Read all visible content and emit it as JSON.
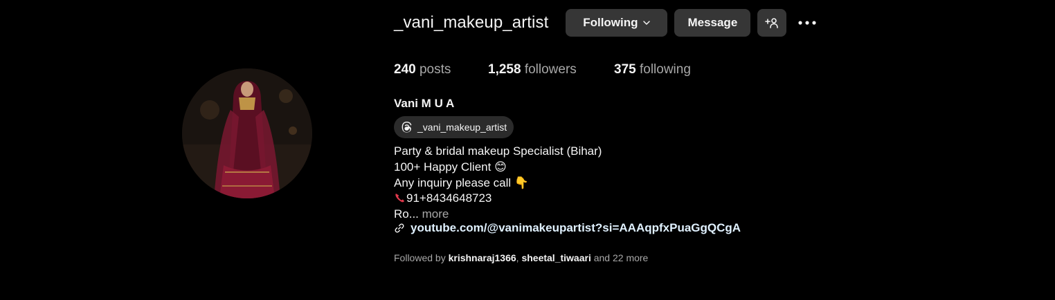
{
  "profile": {
    "username": "_vani_makeup_artist",
    "following_button": "Following",
    "message_button": "Message",
    "posts_count": "240",
    "posts_label": "posts",
    "followers_count": "1,258",
    "followers_label": "followers",
    "following_count": "375",
    "following_label": "following",
    "full_name": "Vani M U A",
    "threads_handle": "_vani_makeup_artist",
    "bio": {
      "line1": "Party & bridal makeup Specialist (Bihar)",
      "line2": "100+ Happy Client 😊",
      "line3": "Any inquiry please call 👇",
      "line4_phone": "91+8434648723",
      "line5_truncated": "Ro...",
      "more_label": "more"
    },
    "link": "youtube.com/@vanimakeupartist?si=AAAqpfxPuaGgQCgA",
    "followed_by": {
      "prefix": "Followed by",
      "user1": "krishnaraj1366",
      "separator": ",",
      "user2": "sheetal_tiwaari",
      "suffix": "and 22 more"
    }
  },
  "icons": {
    "chevron": "chevron-down-icon",
    "suggest": "person-add-icon",
    "options": "more-options-icon",
    "threads": "threads-icon",
    "phone": "phone-icon",
    "link": "link-icon"
  },
  "colors": {
    "background": "#000000",
    "button": "#363636",
    "secondary_text": "#a8a8a8",
    "link_text": "#e0f1ff"
  }
}
